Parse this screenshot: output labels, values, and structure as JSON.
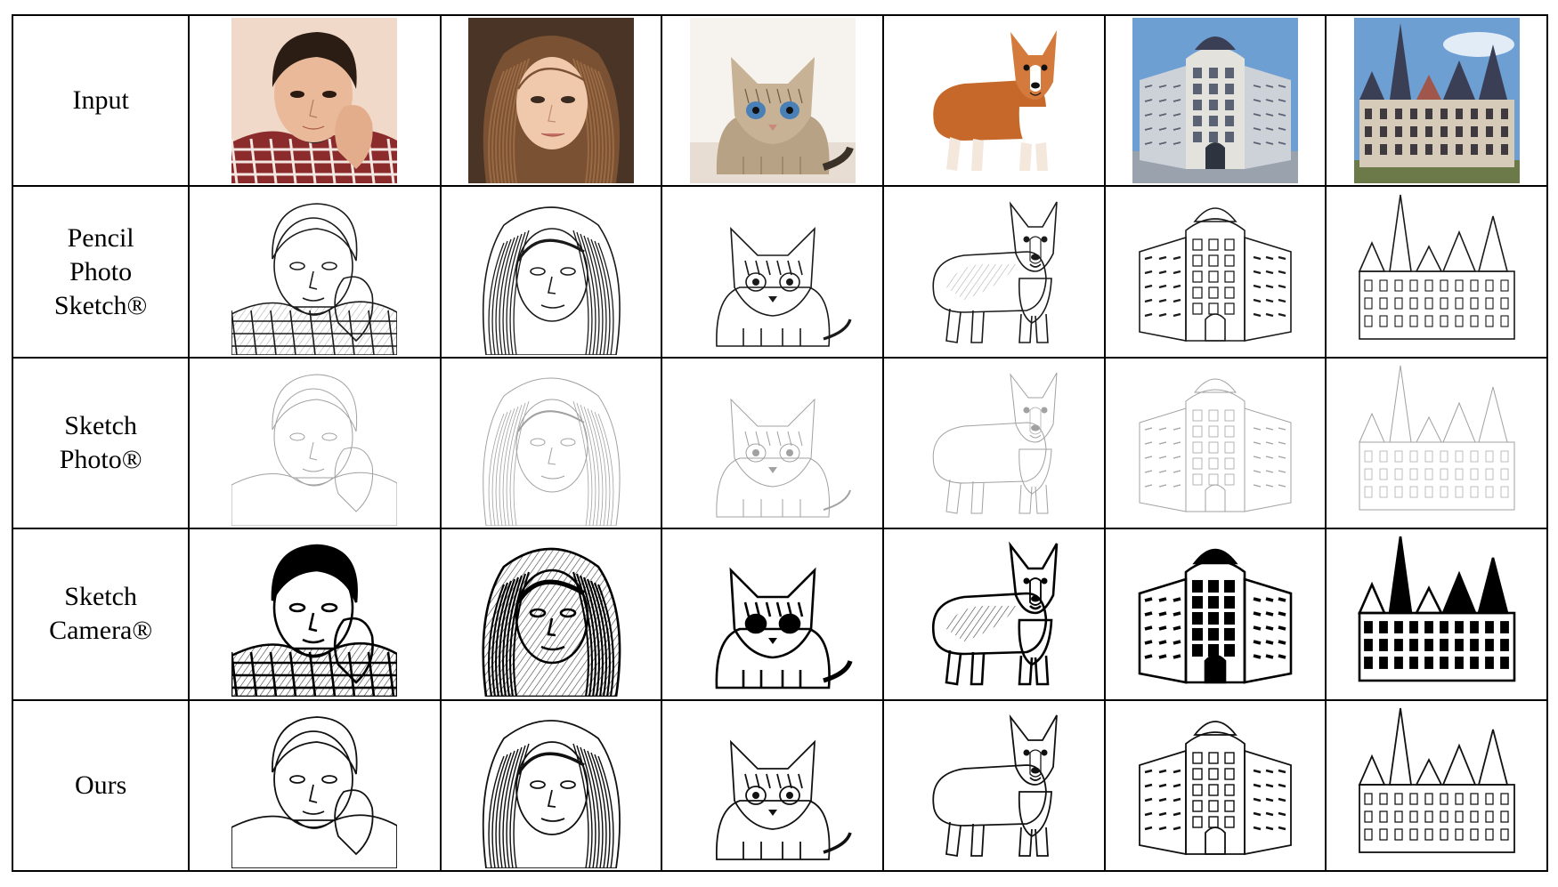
{
  "rows": [
    {
      "name": "row-input",
      "label_lines": [
        "Input"
      ],
      "style": "color"
    },
    {
      "name": "row-pencil-photo-sketch",
      "label_lines": [
        "Pencil",
        "Photo",
        "Sketch®"
      ],
      "style": "pencil"
    },
    {
      "name": "row-sketch-photo",
      "label_lines": [
        "Sketch",
        "Photo®"
      ],
      "style": "faint"
    },
    {
      "name": "row-sketch-camera",
      "label_lines": [
        "Sketch",
        "Camera®"
      ],
      "style": "dark"
    },
    {
      "name": "row-ours",
      "label_lines": [
        "Ours"
      ],
      "style": "ours"
    }
  ],
  "subjects": [
    "man-portrait",
    "woman-portrait",
    "cat",
    "corgi",
    "building",
    "castle"
  ],
  "colors": {
    "border": "#000000",
    "text": "#000000",
    "background": "#ffffff",
    "skin": "#e9b99a",
    "hair_dark": "#2b1d14",
    "hair_brown": "#7a5132",
    "plaid": "#8b2b2b",
    "cat_fur": "#b8a286",
    "corgi_fur": "#c7682b",
    "sky": "#6d9fd3",
    "stone": "#d6cbb8",
    "roof": "#3a3f56"
  }
}
